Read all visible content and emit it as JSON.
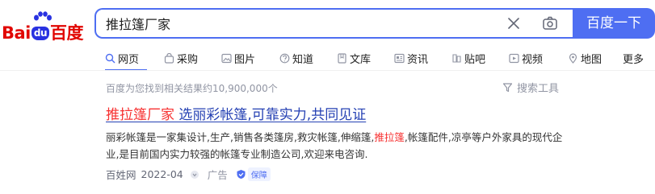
{
  "logo": {
    "bai": "Bai",
    "du": "du",
    "cn": "百度"
  },
  "search": {
    "value": "推拉篷厂家",
    "button_label": "百度一下"
  },
  "tabs": [
    {
      "label": "网页",
      "icon": "search-icon"
    },
    {
      "label": "采购",
      "icon": "shopping-bag-icon"
    },
    {
      "label": "图片",
      "icon": "image-icon"
    },
    {
      "label": "知道",
      "icon": "question-icon"
    },
    {
      "label": "文库",
      "icon": "document-icon"
    },
    {
      "label": "资讯",
      "icon": "news-icon"
    },
    {
      "label": "贴吧",
      "icon": "tieba-icon"
    },
    {
      "label": "视频",
      "icon": "video-icon"
    },
    {
      "label": "地图",
      "icon": "map-icon"
    },
    {
      "label": "更多",
      "icon": ""
    }
  ],
  "results_bar": {
    "count_text": "百度为您找到相关结果约10,900,000个",
    "tools_label": "搜索工具"
  },
  "result": {
    "title_highlight": "推拉篷厂家",
    "title_rest": " 选丽彩帐篷,可靠实力,共同见证",
    "abstract_before": "丽彩帐篷是一家集设计,生产,销售各类篷房,救灾帐篷,伸缩篷,",
    "abstract_highlight": "推拉篷",
    "abstract_after": ",帐篷配件,凉亭等户外家具的现代企业,是目前国内实力较强的帐篷专业制造公司,欢迎来电咨询.",
    "source": "百姓网",
    "date": "2022-04",
    "ad_label": "广告",
    "badge_label": "保障"
  },
  "colors": {
    "accent": "#4e6ef2",
    "highlight": "#f73131",
    "link": "#2440b3",
    "brand_red": "#e10602"
  }
}
